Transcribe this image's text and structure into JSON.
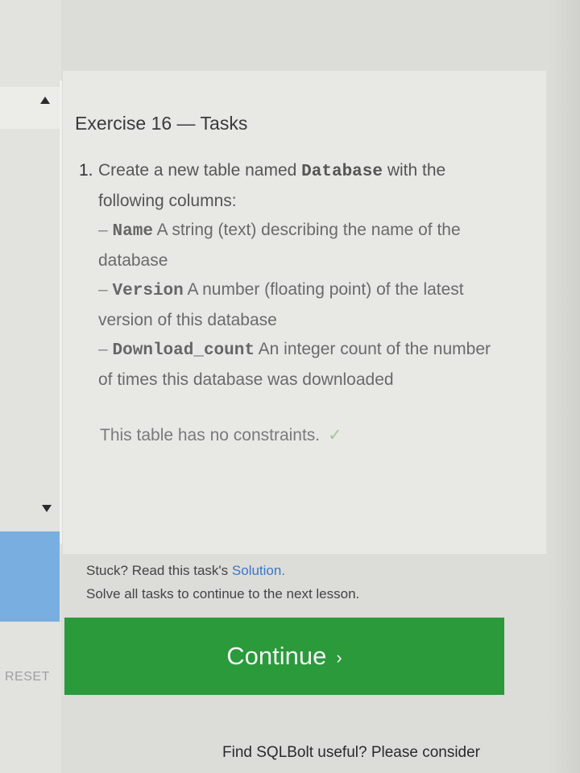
{
  "lesson": {
    "title": "Exercise 16 — Tasks",
    "task_number": "1.",
    "task_intro_pre": "Create a new table named",
    "table_name": "Database",
    "task_intro_post": "with the following columns:",
    "columns": [
      {
        "dash": "–",
        "name": "Name",
        "desc": "A string (text) describing the name of the database"
      },
      {
        "dash": "–",
        "name": "Version",
        "desc": "A number (floating point) of the latest version of this database"
      },
      {
        "dash": "–",
        "name": "Download_count",
        "desc": "An integer count of the number of times this database was downloaded"
      }
    ],
    "note": "This table has no constraints.",
    "check_icon": "✓"
  },
  "help": {
    "stuck_prefix": "Stuck? Read this task's",
    "solution_link": "Solution",
    "stuck_suffix": ".",
    "solve_all": "Solve all tasks to continue to the next lesson."
  },
  "actions": {
    "continue_label": "Continue",
    "continue_chevron": "›",
    "reset_label": "RESET"
  },
  "footer": {
    "text": "Find SQLBolt useful? Please consider"
  },
  "colors": {
    "continue_bg": "#2a9a3a",
    "link": "#3c77c7",
    "scrollbar_accent": "#79aee0"
  }
}
